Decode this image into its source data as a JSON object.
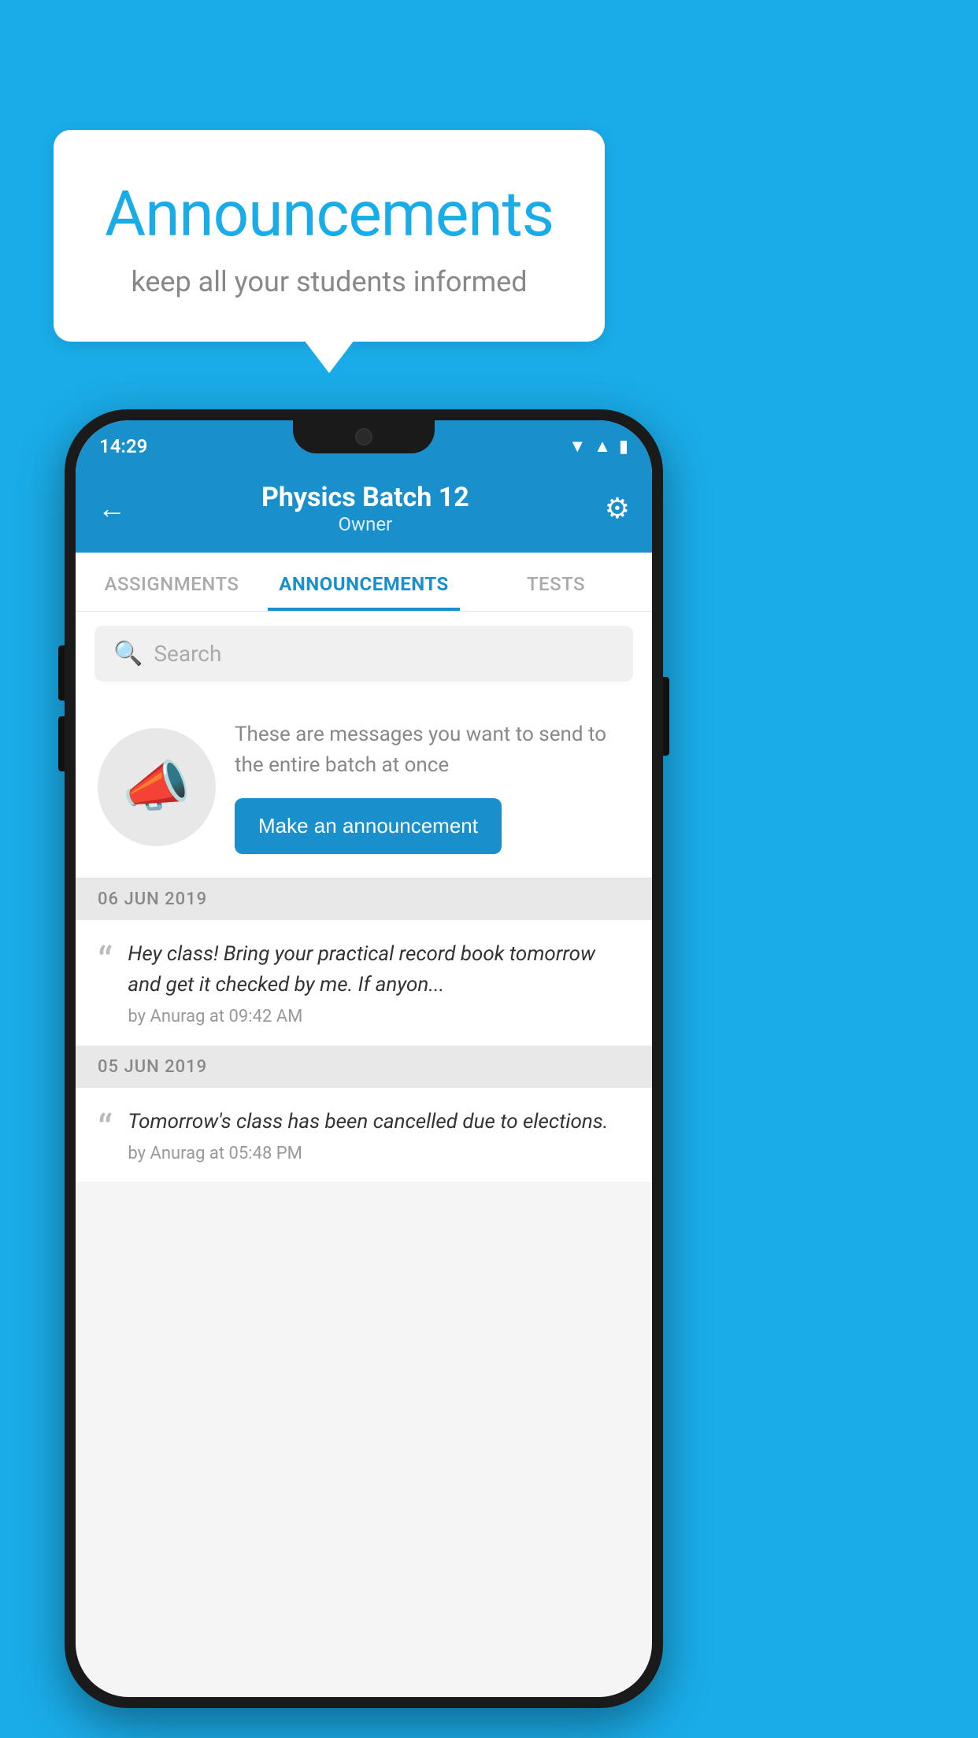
{
  "background_color": "#1AACE8",
  "speech_bubble": {
    "title": "Announcements",
    "subtitle": "keep all your students informed"
  },
  "phone": {
    "status_bar": {
      "time": "14:29",
      "icons": [
        "wifi",
        "signal",
        "battery"
      ]
    },
    "header": {
      "title": "Physics Batch 12",
      "subtitle": "Owner",
      "back_label": "←",
      "gear_label": "⚙"
    },
    "tabs": [
      {
        "label": "ASSIGNMENTS",
        "active": false
      },
      {
        "label": "ANNOUNCEMENTS",
        "active": true
      },
      {
        "label": "TESTS",
        "active": false
      }
    ],
    "search": {
      "placeholder": "Search"
    },
    "promo": {
      "description": "These are messages you want to send to the entire batch at once",
      "button_label": "Make an announcement"
    },
    "announcements": [
      {
        "date": "06  JUN  2019",
        "text": "Hey class! Bring your practical record book tomorrow and get it checked by me. If anyon...",
        "meta": "by Anurag at 09:42 AM"
      },
      {
        "date": "05  JUN  2019",
        "text": "Tomorrow's class has been cancelled due to elections.",
        "meta": "by Anurag at 05:48 PM"
      }
    ]
  }
}
